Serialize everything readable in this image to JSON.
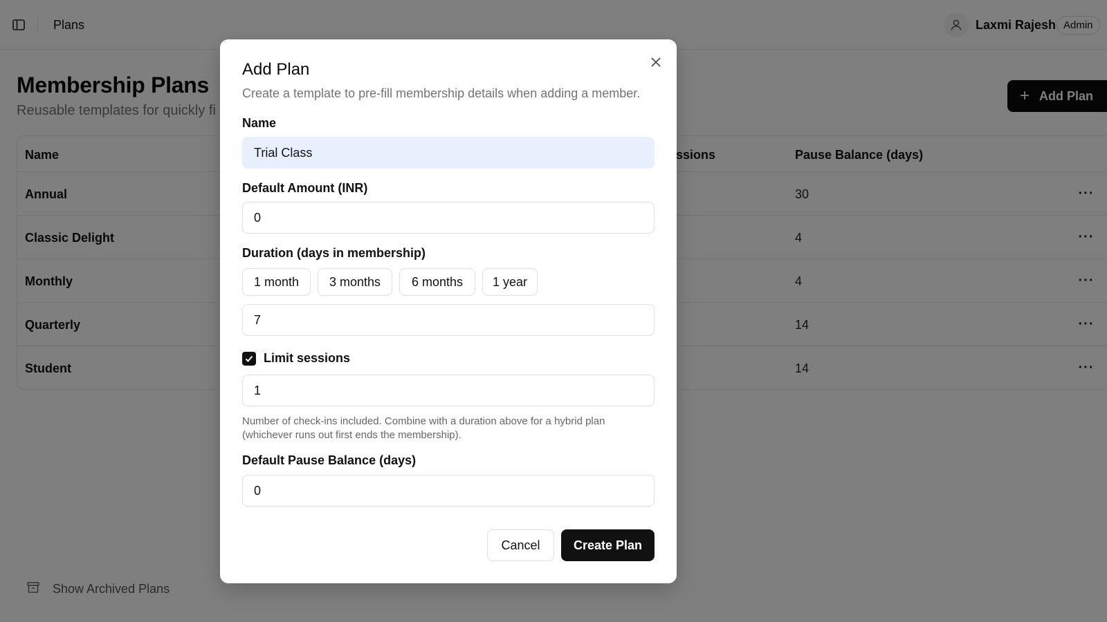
{
  "topbar": {
    "breadcrumb": "Plans",
    "user_name": "Laxmi Rajesh",
    "user_role": "Admin"
  },
  "page": {
    "title": "Membership Plans",
    "subtitle": "Reusable templates for quickly fi",
    "add_button_label": "Add Plan"
  },
  "table": {
    "columns": [
      "Name",
      "ssions",
      "Pause Balance (days)"
    ],
    "rows": [
      {
        "name": "Annual",
        "pause_balance": "30"
      },
      {
        "name": "Classic Delight",
        "pause_balance": "4"
      },
      {
        "name": "Monthly",
        "pause_balance": "4"
      },
      {
        "name": "Quarterly",
        "pause_balance": "14"
      },
      {
        "name": "Student",
        "pause_balance": "14"
      }
    ],
    "row_menu_glyph": "···"
  },
  "footer": {
    "archived_label": "Show Archived Plans"
  },
  "dialog": {
    "title": "Add Plan",
    "description": "Create a template to pre-fill membership details when adding a member.",
    "name_label": "Name",
    "name_value": "Trial Class",
    "amount_label": "Default Amount (INR)",
    "amount_value": "0",
    "duration_label": "Duration (days in membership)",
    "duration_presets": [
      "1 month",
      "3 months",
      "6 months",
      "1 year"
    ],
    "duration_value": "7",
    "limit_sessions_label": "Limit sessions",
    "limit_sessions_checked": true,
    "sessions_value": "1",
    "sessions_hint": "Number of check-ins included. Combine with a duration above for a hybrid plan (whichever runs out first ends the membership).",
    "pause_label": "Default Pause Balance (days)",
    "pause_value": "0",
    "cancel_label": "Cancel",
    "create_label": "Create Plan"
  }
}
